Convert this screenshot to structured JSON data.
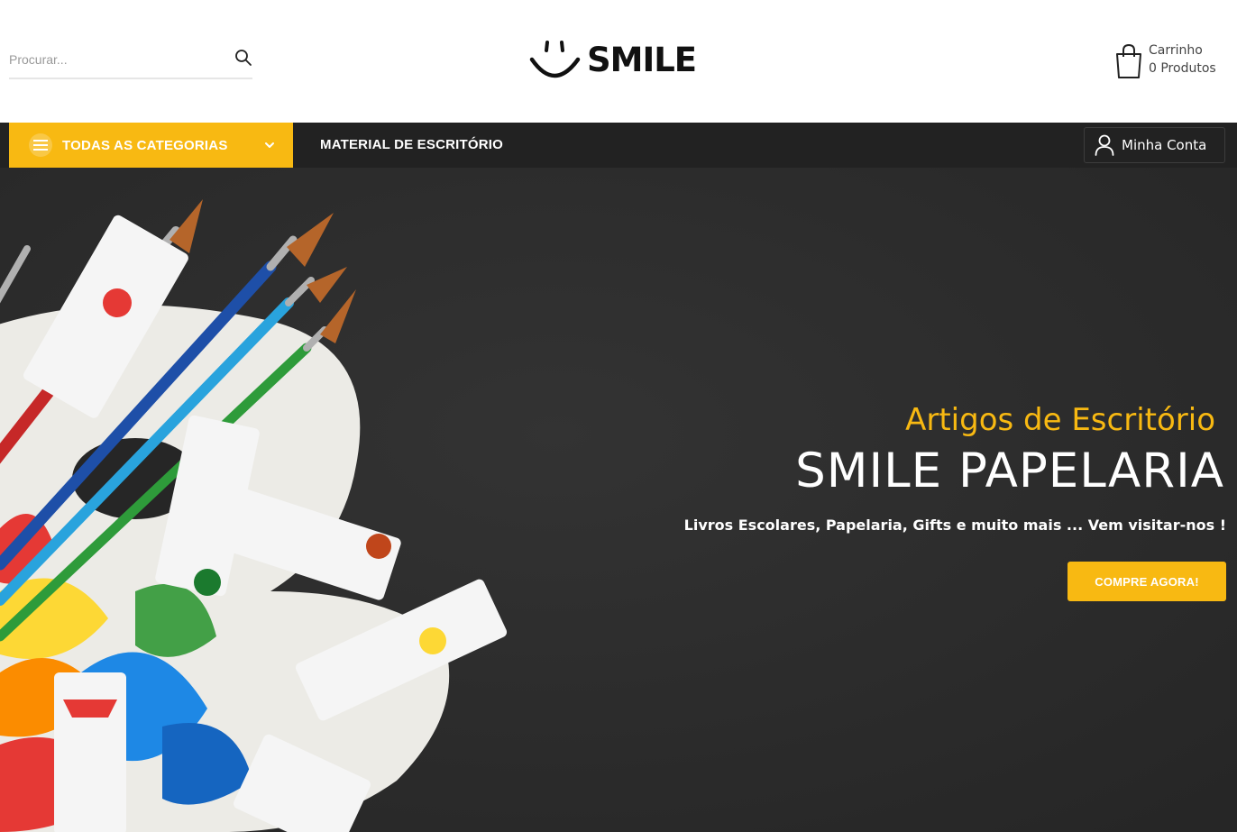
{
  "header": {
    "search": {
      "placeholder": "Procurar..."
    },
    "logo_text": "SMILE",
    "cart": {
      "label": "Carrinho",
      "count_text": "0 Produtos"
    }
  },
  "nav": {
    "categories_label": "TODAS AS CATEGORIAS",
    "links": [
      "MATERIAL DE ESCRITÓRIO"
    ],
    "account_label": "Minha Conta"
  },
  "hero": {
    "subtitle": "Artigos de Escritório",
    "title": "SMILE PAPELARIA",
    "tagline": "Livros Escolares, Papelaria, Gifts e muito mais ... Vem visitar-nos !",
    "cta_label": "COMPRE AGORA!",
    "image_name": "art-supplies-palette-image"
  },
  "colors": {
    "accent": "#f8b912",
    "navbar": "#222222",
    "hero_bg": "#2b2b2b"
  },
  "icons": [
    "search-icon",
    "smile-logo-icon",
    "shopping-bag-icon",
    "menu-icon",
    "chevron-down-icon",
    "user-icon"
  ]
}
